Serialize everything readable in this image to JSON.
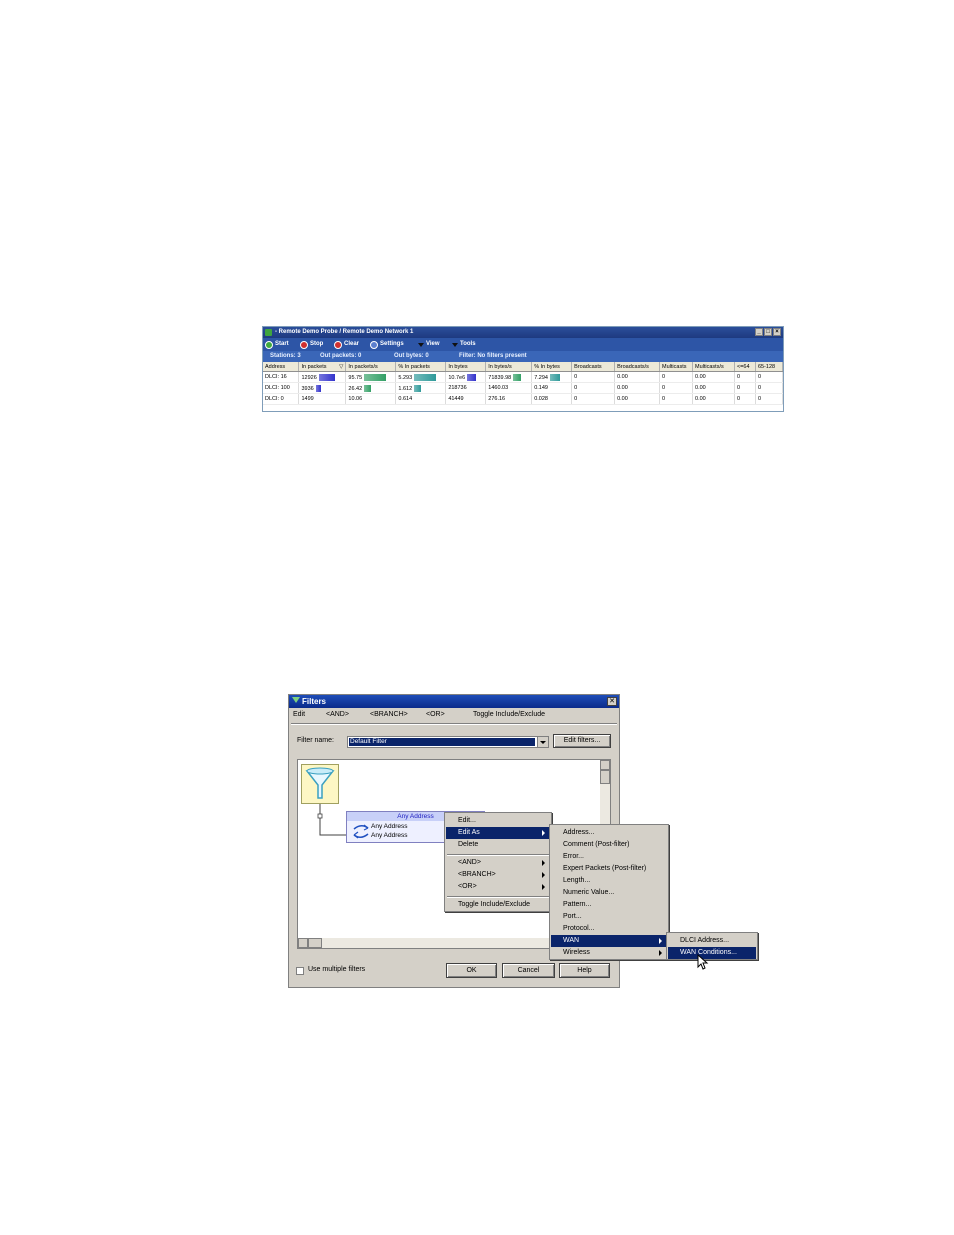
{
  "probe": {
    "title": "- Remote Demo Probe / Remote Demo Network 1",
    "toolbar": {
      "start": "Start",
      "stop": "Stop",
      "clear": "Clear",
      "settings": "Settings",
      "view": "View",
      "tools": "Tools"
    },
    "status": {
      "stations": "Stations: 3",
      "out_packets": "Out packets: 0",
      "out_bytes": "Out bytes: 0",
      "filter": "Filter: No filters present"
    },
    "columns": [
      "Address",
      "In packets",
      "In packets/s",
      "% In packets",
      "In bytes",
      "In bytes/s",
      "% In bytes",
      "Broadcasts",
      "Broadcasts/s",
      "Multicasts",
      "Multicasts/s",
      "<=64",
      "65-128"
    ],
    "sort_icon": "sort-desc-icon",
    "rows": [
      [
        "DLCI: 16",
        "12926",
        "95.75",
        "5.293",
        "10.7e6",
        "71839.98",
        "7.294",
        "0",
        "0.00",
        "0",
        "0.00",
        "0",
        "0"
      ],
      [
        "DLCI: 100",
        "3936",
        "26.42",
        "1.612",
        "218736",
        "1460.03",
        "0.149",
        "0",
        "0.00",
        "0",
        "0.00",
        "0",
        "0"
      ],
      [
        "DLCI: 0",
        "1499",
        "10.06",
        "0.614",
        "41449",
        "276.16",
        "0.028",
        "0",
        "0.00",
        "0",
        "0.00",
        "0",
        "0"
      ]
    ],
    "bars": [
      {
        "in_packets": 1.0,
        "in_packets_s": 1.0,
        "pct_in_packets": 1.0,
        "in_bytes": 0.4,
        "in_bytes_s": 0.35,
        "pct_in_bytes": 0.45
      },
      {
        "in_packets": 0.3,
        "in_packets_s": 0.3,
        "pct_in_packets": 0.3,
        "in_bytes": 0,
        "in_bytes_s": 0,
        "pct_in_bytes": 0
      },
      {
        "in_packets": 0,
        "in_packets_s": 0,
        "pct_in_packets": 0,
        "in_bytes": 0,
        "in_bytes_s": 0,
        "pct_in_bytes": 0
      }
    ],
    "colors": {
      "titlebar": "#1e3a80",
      "bar_blue": "#3333cc",
      "bar_green": "#33a066",
      "bar_teal": "#2f9a9a"
    }
  },
  "filters": {
    "title": "Filters",
    "menu": [
      "Edit",
      "<AND>",
      "<BRANCH>",
      "<OR>",
      "Toggle Include/Exclude"
    ],
    "filter_name_label": "Filter name:",
    "filter_name_value": "Default Filter",
    "edit_filters_label": "Edit filters...",
    "node_head": "Any Address",
    "node_line1": "Any Address",
    "node_line2": "Any Address",
    "use_multiple_label": "Use multiple filters",
    "ok_label": "OK",
    "cancel_label": "Cancel",
    "help_label": "Help"
  },
  "context_menu": {
    "items": [
      "Edit...",
      "Edit As",
      "Delete",
      "<AND>",
      "<BRANCH>",
      "<OR>",
      "Toggle Include/Exclude"
    ]
  },
  "edit_as_menu": {
    "items": [
      "Address...",
      "Comment (Post-filter)",
      "Error...",
      "Expert Packets (Post-filter)",
      "Length...",
      "Numeric Value...",
      "Pattern...",
      "Port...",
      "Protocol...",
      "WAN",
      "Wireless"
    ]
  },
  "wan_menu": {
    "items": [
      "DLCI Address...",
      "WAN Conditions..."
    ]
  }
}
